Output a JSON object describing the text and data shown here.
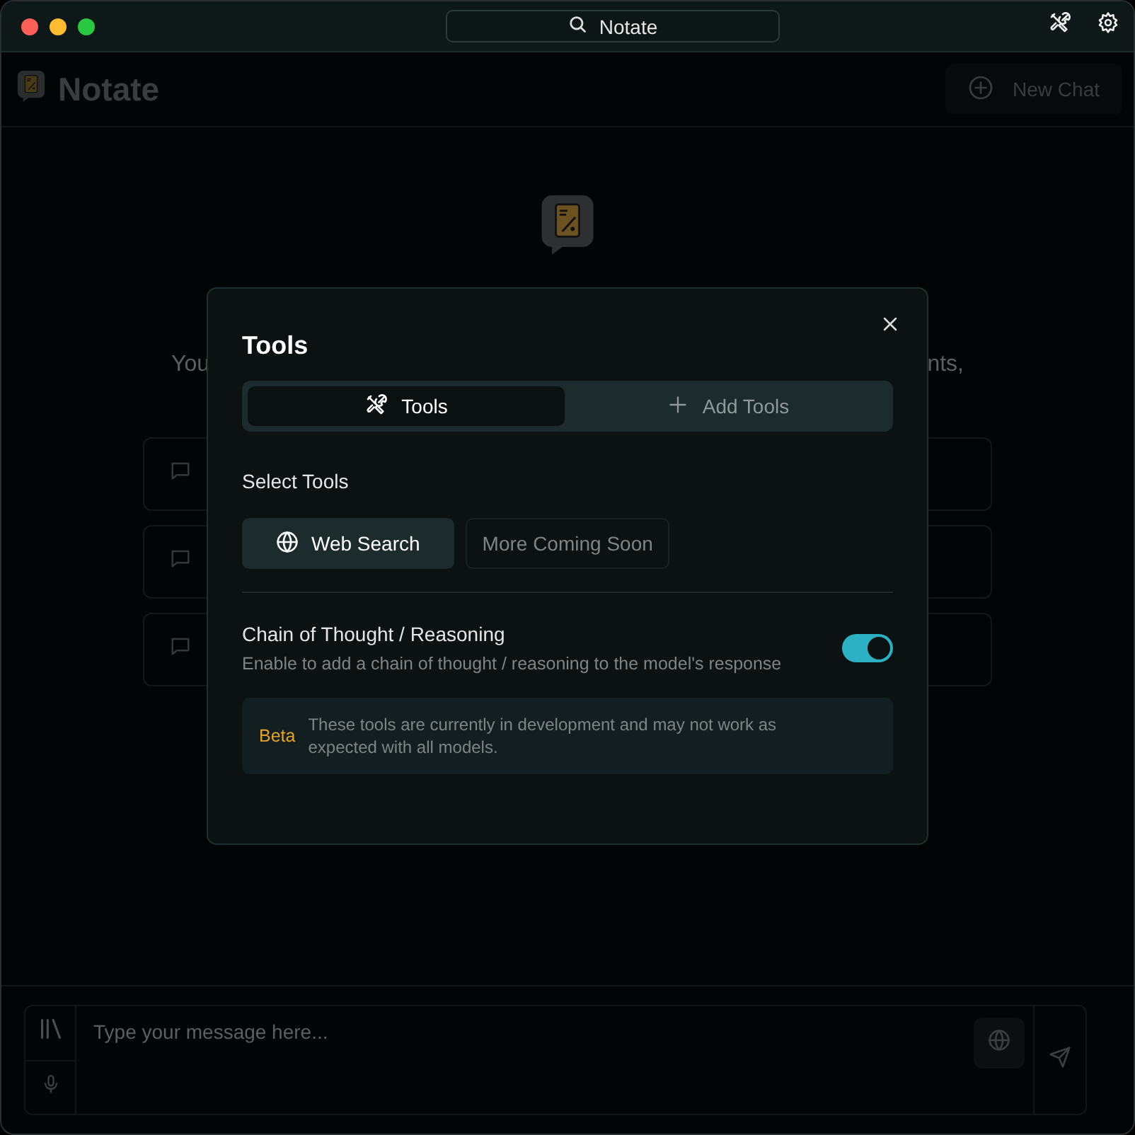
{
  "window": {
    "title": "Notate"
  },
  "header": {
    "app_name": "Notate",
    "new_chat_button": "New Chat"
  },
  "welcome": {
    "text_left": "You",
    "text_right": "nts,"
  },
  "composer": {
    "placeholder": "Type your message here..."
  },
  "dialog": {
    "title": "Tools",
    "tabs": [
      {
        "label": "Tools",
        "selected": true
      },
      {
        "label": "Add Tools",
        "selected": false
      }
    ],
    "section_label": "Select Tools",
    "tool_options": [
      {
        "label": "Web Search",
        "selected": true
      },
      {
        "label": "More Coming Soon",
        "selected": false
      }
    ],
    "setting": {
      "title": "Chain of Thought / Reasoning",
      "description": "Enable to add a chain of thought / reasoning to the model's response",
      "on": true
    },
    "notice": {
      "badge": "Beta",
      "text": "These tools are currently in development and may not work as expected with all models."
    }
  }
}
